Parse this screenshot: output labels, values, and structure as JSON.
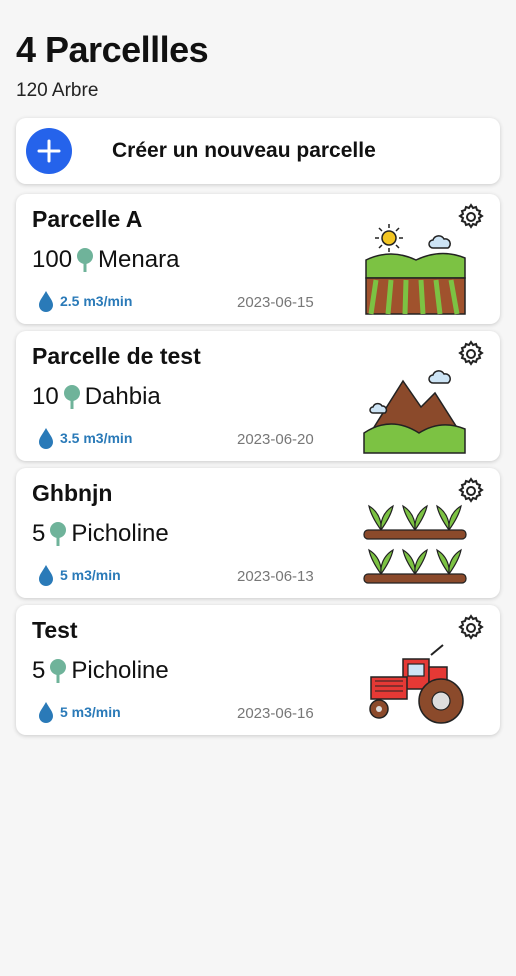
{
  "header": {
    "title": "4 Parcellles",
    "subtitle": "120 Arbre"
  },
  "create": {
    "label": "Créer un nouveau parcelle"
  },
  "colors": {
    "accent": "#2563eb",
    "flow": "#2a7ab8",
    "tree": "#6fb39a"
  },
  "parcels": [
    {
      "name": "Parcelle A",
      "count": "100",
      "variety": "Menara",
      "flow": "2.5 m3/min",
      "date": "2023-06-15",
      "icon": "farm-field-icon"
    },
    {
      "name": "Parcelle de test",
      "count": "10",
      "variety": "Dahbia",
      "flow": "3.5 m3/min",
      "date": "2023-06-20",
      "icon": "mountain-icon"
    },
    {
      "name": "Ghbnjn",
      "count": "5",
      "variety": "Picholine",
      "flow": "5 m3/min",
      "date": "2023-06-13",
      "icon": "plant-rows-icon"
    },
    {
      "name": "Test",
      "count": "5",
      "variety": "Picholine",
      "flow": "5 m3/min",
      "date": "2023-06-16",
      "icon": "tractor-icon"
    }
  ]
}
